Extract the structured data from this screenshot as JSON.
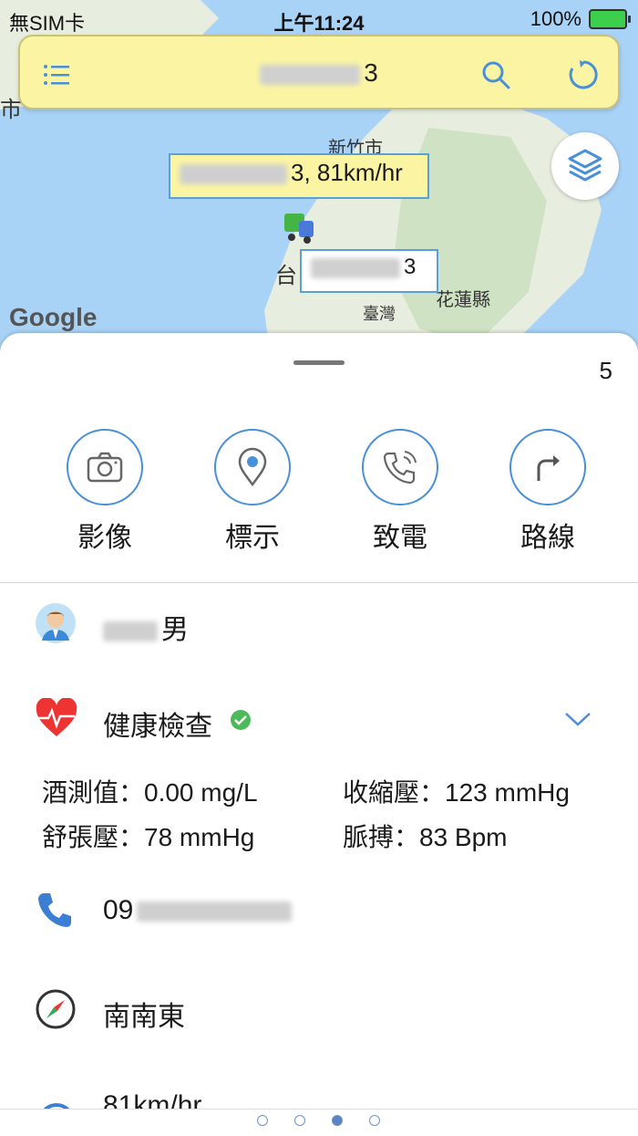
{
  "status_bar": {
    "carrier": "無SIM卡",
    "time": "上午11:24",
    "battery": "100%"
  },
  "topbar": {
    "vehicle_suffix": "3"
  },
  "map": {
    "city_hsinchu": "新竹市",
    "city_taichung": "台",
    "city_hualien": "花蓮縣",
    "region_taiwan": "臺灣",
    "left_edge_label": "市",
    "vehicle_tag_suffix": "3, 81km/hr",
    "vehicle_marker_suffix": "3",
    "google_logo": "Google"
  },
  "sheet": {
    "count": "5",
    "actions": [
      {
        "label": "影像",
        "icon": "camera-icon"
      },
      {
        "label": "標示",
        "icon": "location-pin-icon"
      },
      {
        "label": "致電",
        "icon": "phone-call-icon"
      },
      {
        "label": "路線",
        "icon": "route-arrow-icon"
      }
    ],
    "driver_suffix": "男",
    "health_title": "健康檢查",
    "alcohol": "酒測值：0.00 mg/L",
    "systolic": "收縮壓：123 mmHg",
    "diastolic": "舒張壓：78 mmHg",
    "pulse": "脈搏：83 Bpm",
    "phone_prefix": "09",
    "direction": "南南東",
    "speed": "81km/hr"
  },
  "pager": {
    "pages": 4,
    "current": 3
  },
  "colors": {
    "accent": "#4a90d9",
    "topbar_bg": "#fbf5a3",
    "map_water": "#a9d2f7",
    "map_land": "#e8eedf"
  }
}
